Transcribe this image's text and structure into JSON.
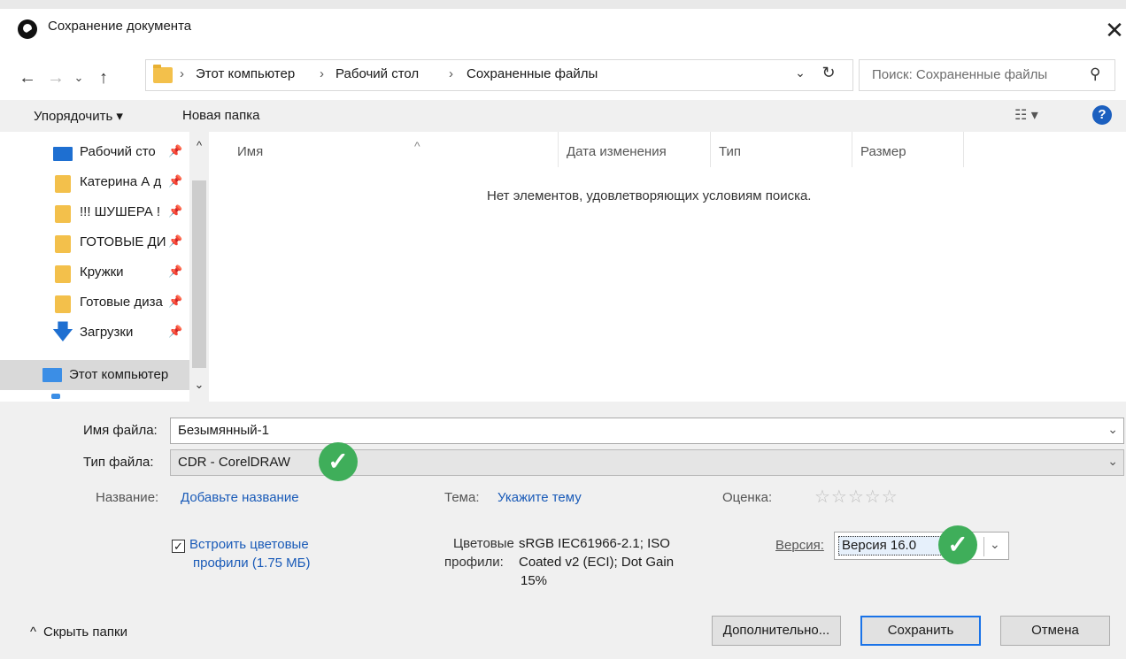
{
  "window": {
    "title": "Сохранение документа",
    "close_glyph": "✕"
  },
  "nav": {
    "back": "←",
    "forward": "→",
    "recent": "⌄",
    "up": "↑"
  },
  "address": {
    "sep": "›",
    "crumbs": [
      "Этот компьютер",
      "Рабочий стол",
      "Сохраненные файлы"
    ],
    "dropdown": "⌄",
    "refresh": "↻"
  },
  "search": {
    "placeholder": "Поиск: Сохраненные файлы",
    "icon": "⚲"
  },
  "toolbar": {
    "organize": "Упорядочить ▾",
    "new_folder": "Новая папка",
    "view": "☷ ▾",
    "help": "?"
  },
  "sidebar": {
    "items": [
      {
        "label": "Рабочий сто",
        "pin": "📌",
        "icon": "desktop-icon"
      },
      {
        "label": "Катерина А д",
        "pin": "📌",
        "icon": "folder-icon"
      },
      {
        "label": "!!! ШУШЕРА !",
        "pin": "📌",
        "icon": "folder-icon"
      },
      {
        "label": "ГОТОВЫЕ ДИ",
        "pin": "📌",
        "icon": "folder-icon"
      },
      {
        "label": "Кружки",
        "pin": "📌",
        "icon": "folder-icon"
      },
      {
        "label": "Готовые диза",
        "pin": "📌",
        "icon": "folder-icon"
      },
      {
        "label": "Загрузки",
        "pin": "📌",
        "icon": "download-icon"
      },
      {
        "label": "Этот компьютер",
        "pin": "",
        "icon": "computer-icon"
      }
    ],
    "scroll_up": "^",
    "scroll_down": "⌄"
  },
  "filelist": {
    "columns": [
      "Имя",
      "Дата изменения",
      "Тип",
      "Размер"
    ],
    "sort_indicator": "^",
    "empty_message": "Нет элементов, удовлетворяющих условиям поиска."
  },
  "form": {
    "filename_label": "Имя файла:",
    "filename_value": "Безымянный-1",
    "filetype_label": "Тип файла:",
    "filetype_value": "CDR - CorelDRAW",
    "dropdown": "⌄",
    "check": "✓",
    "title_label": "Название:",
    "title_link": "Добавьте название",
    "subject_label": "Тема:",
    "subject_link": "Укажите тему",
    "rating_label": "Оценка:",
    "rating_stars": "☆☆☆☆☆",
    "rating_value": 0,
    "embed_line1": "Встроить цветовые",
    "embed_line2": "профили (1.75 МБ)",
    "embed_checked": true,
    "profiles_label1": "Цветовые",
    "profiles_label2": "профили:",
    "profiles_value1": "sRGB IEC61966-2.1; ISO",
    "profiles_value2": "Coated v2 (ECI); Dot Gain",
    "profiles_value3": "15%",
    "version_label": "Версия:",
    "version_value": "Версия 16.0"
  },
  "buttons": {
    "advanced": "Дополнительно...",
    "save": "Сохранить",
    "cancel": "Отмена",
    "hide_folders": "Скрыть папки",
    "hide_folders_icon": "^"
  },
  "colors": {
    "accent": "#1a73e8",
    "link": "#1a5bb8",
    "check_badge": "#3fae5a",
    "folder": "#f3c04b"
  }
}
